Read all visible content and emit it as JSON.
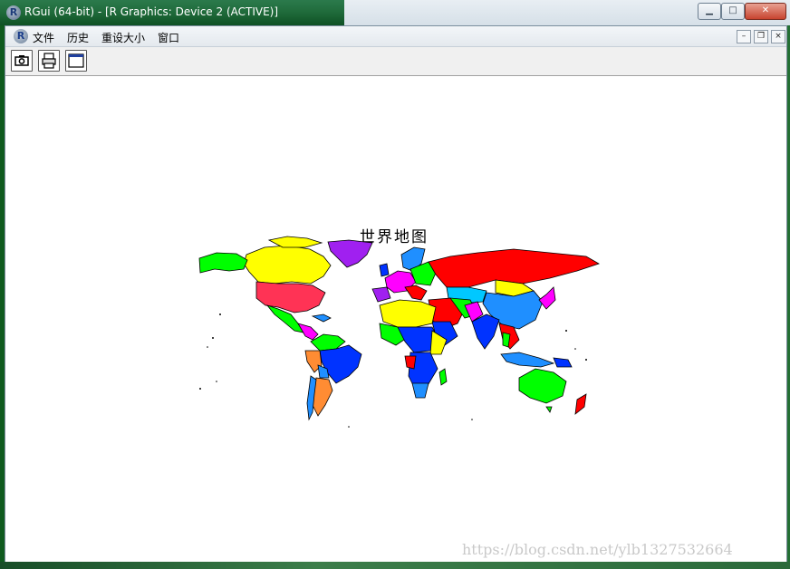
{
  "window": {
    "title": "RGui (64-bit) - [R Graphics: Device 2 (ACTIVE)]",
    "app_icon": "R",
    "controls": {
      "minimize_icon": "minimize-icon",
      "maximize_icon": "maximize-icon",
      "close_icon": "close-icon"
    }
  },
  "menubar": {
    "r_icon": "R",
    "items": [
      "文件",
      "历史",
      "重设大小",
      "窗口"
    ],
    "mdi_controls": [
      "–",
      "❐",
      "×"
    ]
  },
  "toolbar": {
    "buttons": [
      {
        "icon": "camera-icon"
      },
      {
        "icon": "printer-icon"
      },
      {
        "icon": "window-icon"
      }
    ]
  },
  "plot": {
    "title": "世界地图",
    "watermark": "https://blog.csdn.net/ylb1327532664"
  },
  "colors": {
    "red": "#ff0000",
    "yellow": "#ffff00",
    "purple": "#a020f0",
    "green": "#00ff00",
    "blue": "#0033ff",
    "light_blue": "#1f8fff",
    "orange": "#ff8c33",
    "magenta": "#ff00ff",
    "cyan": "#00c8ff"
  }
}
